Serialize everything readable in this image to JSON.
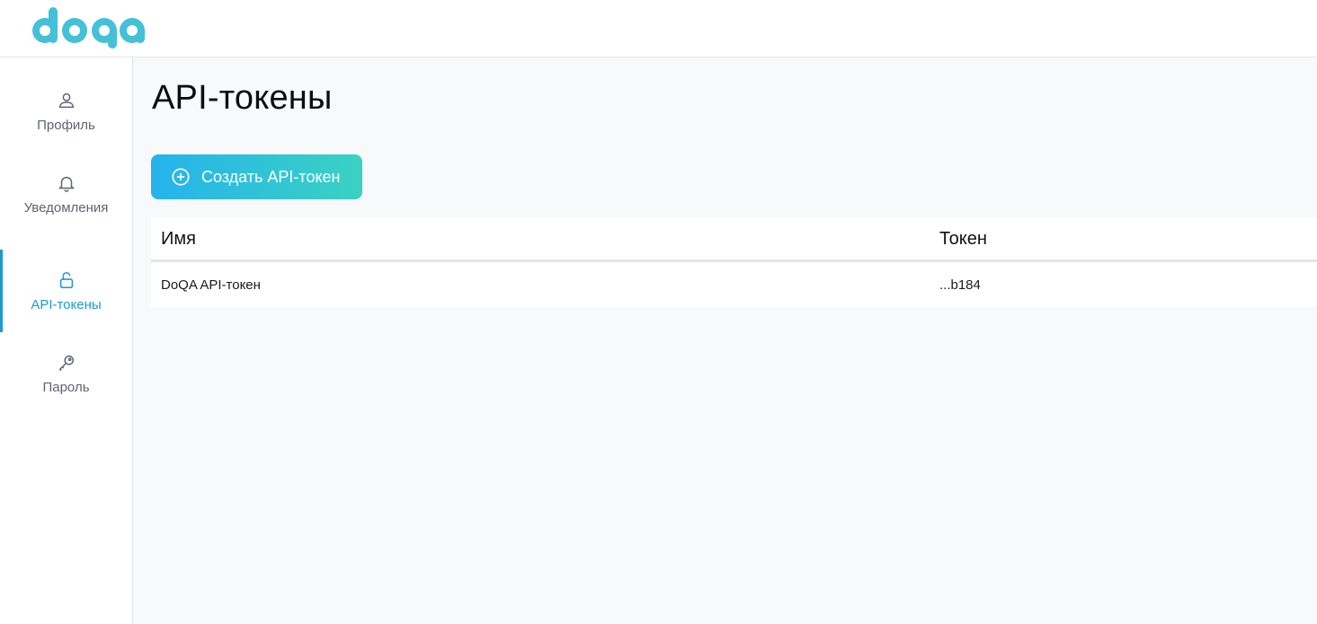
{
  "brand": {
    "name": "doqa",
    "colors": {
      "logo": "#45c0d6",
      "accent": "#1e9ad0",
      "button_start": "#25b3ec",
      "button_end": "#39d2c2"
    }
  },
  "sidebar": {
    "items": [
      {
        "label": "Профиль",
        "icon": "user-icon",
        "active": false
      },
      {
        "label": "Уведомления",
        "icon": "bell-icon",
        "active": false
      },
      {
        "label": "API-токены",
        "icon": "lock-icon",
        "active": true
      },
      {
        "label": "Пароль",
        "icon": "key-icon",
        "active": false
      }
    ]
  },
  "main": {
    "title": "API-токены",
    "create_button": {
      "label": "Создать API-токен",
      "icon": "plus-circle-icon"
    },
    "table": {
      "columns": [
        "Имя",
        "Токен"
      ],
      "rows": [
        {
          "name": "DoQA API-токен",
          "token": "...b184"
        }
      ]
    }
  }
}
